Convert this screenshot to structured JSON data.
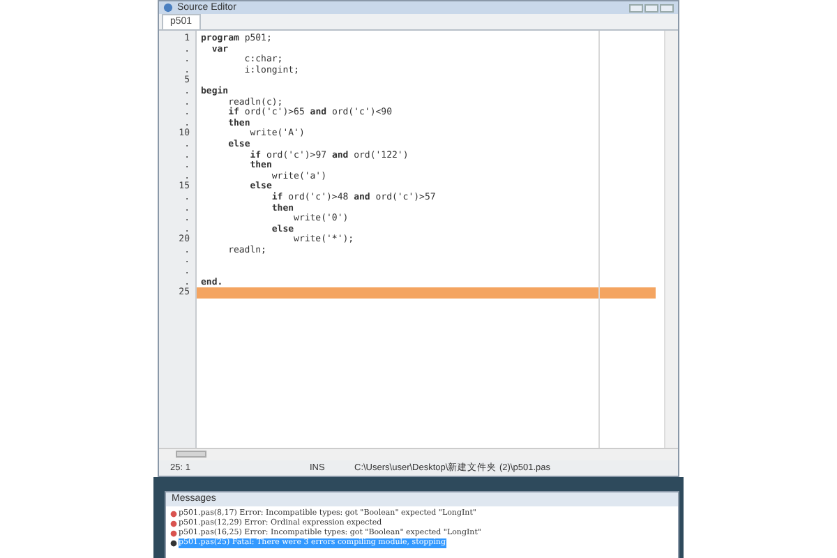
{
  "editor_window": {
    "title": "Source Editor"
  },
  "tabs": [
    {
      "label": "p501",
      "selected": true
    }
  ],
  "code_lines": [
    {
      "number": "1",
      "text": "**program** p501;",
      "current": false
    },
    {
      "number": ".",
      "text": "  **var**",
      "current": false
    },
    {
      "number": ".",
      "text": "        c:char;",
      "current": false
    },
    {
      "number": ".",
      "text": "        i:longint;",
      "current": false
    },
    {
      "number": "5",
      "current": false
    },
    {
      "number": ".",
      "text": "**begin**",
      "current": false
    },
    {
      "number": ".",
      "text": "     readln(c);",
      "current": false
    },
    {
      "number": ".",
      "text": "     **if** ord('c')>65 **and** ord('c')<90",
      "current": false
    },
    {
      "number": ".",
      "text": "     **then**",
      "current": false
    },
    {
      "number": "10",
      "text": "         write('A')",
      "current": false
    },
    {
      "number": ".",
      "text": "     **else**",
      "current": false
    },
    {
      "number": ".",
      "text": "         **if** ord('c')>97 **and** ord('122')",
      "current": false
    },
    {
      "number": ".",
      "text": "         **then**",
      "current": false
    },
    {
      "number": ".",
      "text": "             write('a')",
      "current": false
    },
    {
      "number": "15",
      "text": "         **else**",
      "current": false
    },
    {
      "number": ".",
      "text": "             **if** ord('c')>48 **and** ord('c')>57",
      "current": false
    },
    {
      "number": ".",
      "text": "             **then**",
      "current": false
    },
    {
      "number": ".",
      "text": "                 write('0')",
      "current": false
    },
    {
      "number": ".",
      "text": "             **else**",
      "current": false
    },
    {
      "number": "20",
      "text": "                 write('*');",
      "current": false
    },
    {
      "number": ".",
      "text": "     readln;",
      "current": false
    },
    {
      "number": ".",
      "current": false
    },
    {
      "number": ".",
      "current": false
    },
    {
      "number": ".",
      "text": "**end.**",
      "current": false
    },
    {
      "number": "25",
      "current": true
    }
  ],
  "status_bar": {
    "position": "25: 1",
    "mode": "INS",
    "path": "C:\\Users\\user\\Desktop\\新建文件夹 (2)\\p501.pas"
  },
  "messages_window": {
    "title": "Messages"
  },
  "messages": [
    {
      "kind": "error",
      "text": "p501.pas(8,17) Error: Incompatible types: got \"Boolean\" expected \"LongInt\"",
      "selected": false
    },
    {
      "kind": "error",
      "text": "p501.pas(12,29) Error: Ordinal expression expected",
      "selected": false
    },
    {
      "kind": "error",
      "text": "p501.pas(16,25) Error: Incompatible types: got \"Boolean\" expected \"LongInt\"",
      "selected": false
    },
    {
      "kind": "fatal",
      "text": "p501.pas(25) Fatal: There were 3 errors compiling module, stopping",
      "selected": true
    }
  ]
}
